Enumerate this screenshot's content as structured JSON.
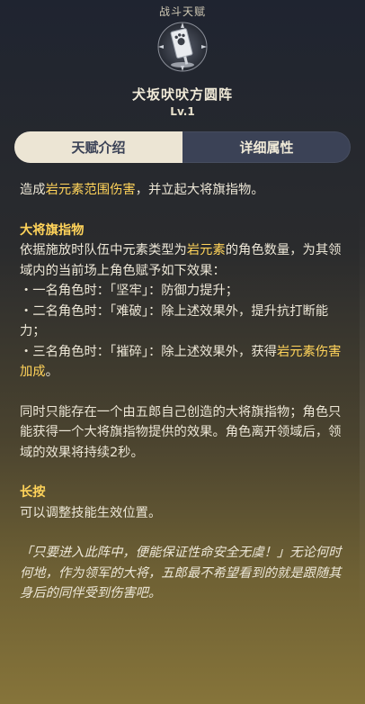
{
  "header": {
    "category": "战斗天赋",
    "icon": "banner-flag-icon",
    "name": "犬坂吠吠方圆阵",
    "level": "Lv.1"
  },
  "tabs": [
    {
      "label": "天赋介绍",
      "active": true
    },
    {
      "label": "详细属性",
      "active": false
    }
  ],
  "description": {
    "intro_pre": "造成",
    "intro_hl": "岩元素范围伤害",
    "intro_post": "，并立起大将旗指物。",
    "section1_title": "大将旗指物",
    "section1_pre": "依据施放时队伍中元素类型为",
    "section1_hl": "岩元素",
    "section1_post": "的角色数量，为其领域内的当前场上角色赋予如下效果：",
    "bullet1": "・一名角色时：「坚牢」：防御力提升；",
    "bullet2": "・二名角色时：「难破」：除上述效果外，提升抗打断能力；",
    "bullet3_pre": "・三名角色时：「摧碎」：除上述效果外，获得",
    "bullet3_hl": "岩元素伤害加成",
    "bullet3_post": "。",
    "para2": "同时只能存在一个由五郎自己创造的大将旗指物；角色只能获得一个大将旗指物提供的效果。角色离开领域后，领域的效果将持续2秒。",
    "section2_title": "长按",
    "section2_text": "可以调整技能生效位置。",
    "quote": "「只要进入此阵中，便能保证性命安全无虞！」无论何时何地，作为领军的大将，五郎最不希望看到的就是跟随其身后的同伴受到伤害吧。"
  },
  "colors": {
    "highlight": "#ffd35a",
    "tab_active_bg": "#ece5d4",
    "tab_bg": "#3b4256"
  }
}
